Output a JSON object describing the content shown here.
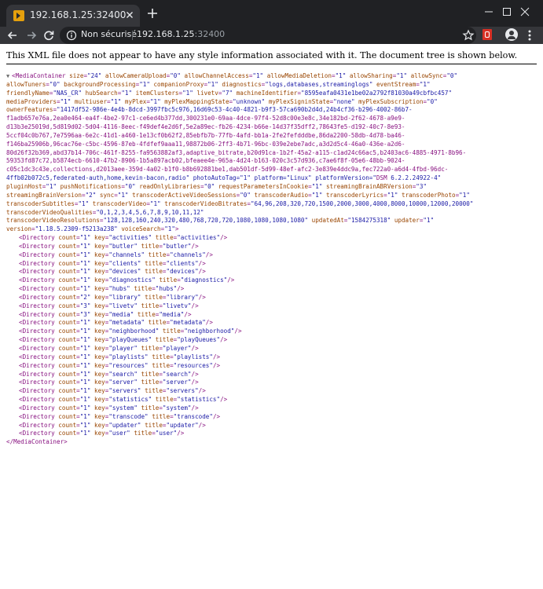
{
  "tab": {
    "title": "192.168.1.25:32400"
  },
  "omnibox": {
    "security_label": "Non sécurisé",
    "host": "192.168.1.25",
    "port": ":32400"
  },
  "page": {
    "info": "This XML file does not appear to have any style information associated with it. The document tree is shown below."
  },
  "xml": {
    "root_open_lines": [
      "<MediaContainer size=\"24\" allowCameraUpload=\"0\" allowChannelAccess=\"1\" allowMediaDeletion=\"1\" allowSharing=\"1\" allowSync=\"0\"",
      "allowTuners=\"0\" backgroundProcessing=\"1\" companionProxy=\"1\" diagnostics=\"logs,databases,streaminglogs\" eventStream=\"1\"",
      "friendlyName=\"NAS_CR\" hubSearch=\"1\" itemClusters=\"1\" livetv=\"7\" machineIdentifier=\"8595eafa0431e1be02a2792f81030a49cbfbc457\"",
      "mediaProviders=\"1\" multiuser=\"1\" myPlex=\"1\" myPlexMappingState=\"unknown\" myPlexSigninState=\"none\" myPlexSubscription=\"0\"",
      "ownerFeatures=\"1417df52-986e-4e4b-8dcd-3997fbc5c976,16d69c53-4c40-4821-b9f3-57ca690b2d4d,24b4cf36-b296-4002-86b7-",
      "f1adb657e76a,2ea0e464-ea4f-4be2-97c1-ce6ed4b377dd,300231e0-69aa-4dce-97f4-52d8c00e3e8c,34e182bd-2f62-4678-a9e9-",
      "d13b3e25019d,5d819d02-5d04-4116-8eec-f49def4e2d6f,5e2a89ec-fb26-4234-b66e-14d37f35dff2,78643fe5-d192-40c7-8e93-",
      "5ccf04c0b767,7e7596aa-6e2c-41d1-a460-1e13cf0b62f2,85ebfb7b-77fb-4afd-bb1a-2fe2fefdddbe,86da2200-58db-4d78-ba46-",
      "f146ba25906b,96cac76e-c5bc-4596-87eb-4fdfef9aaa11,98872b06-2ff3-4b71-96bc-039e2ebe7adc,a3d2d5c4-46a0-436e-a2d6-",
      "80d26f32b369,abd37b14-706c-461f-8255-fa9563882af3,adaptive_bitrate,b20d91ca-1b2f-45a2-a115-c1ad24c66ac5,b2403ac6-4885-4971-8b96-",
      "59353fd87c72,b5874ecb-6610-47b2-8906-1b5a897acb02,bfeaee4e-965a-4d24-b163-020c3c57d936,c7ae6f8f-05e6-48bb-9024-",
      "c05c1dc3c43e,collections,d2013aee-359d-4a02-b1f0-b8b692881be1,dab501df-5d99-48ef-afc2-3e839e4ddc9a,fec722a0-a6d4-4fbd-96dc-",
      "4ffb02b072c5,federated-auth,home,kevin-bacon,radio\" photoAutoTag=\"1\" platform=\"Linux\" platformVersion=\"DSM 6.2.2.24922-4\"",
      "pluginHost=\"1\" pushNotifications=\"0\" readOnlyLibraries=\"0\" requestParametersInCookie=\"1\" streamingBrainABRVersion=\"3\"",
      "streamingBrainVersion=\"2\" sync=\"1\" transcoderActiveVideoSessions=\"0\" transcoderAudio=\"1\" transcoderLyrics=\"1\" transcoderPhoto=\"1\"",
      "transcoderSubtitles=\"1\" transcoderVideo=\"1\" transcoderVideoBitrates=\"64,96,208,320,720,1500,2000,3000,4000,8000,10000,12000,20000\"",
      "transcoderVideoQualities=\"0,1,2,3,4,5,6,7,8,9,10,11,12\"",
      "transcoderVideoResolutions=\"128,128,160,240,320,480,768,720,720,1080,1080,1080,1080\" updatedAt=\"1584275318\" updater=\"1\"",
      "version=\"1.18.5.2309-f5213a238\" voiceSearch=\"1\">"
    ],
    "directories": [
      "<Directory count=\"1\" key=\"activities\" title=\"activities\"/>",
      "<Directory count=\"1\" key=\"butler\" title=\"butler\"/>",
      "<Directory count=\"1\" key=\"channels\" title=\"channels\"/>",
      "<Directory count=\"1\" key=\"clients\" title=\"clients\"/>",
      "<Directory count=\"1\" key=\"devices\" title=\"devices\"/>",
      "<Directory count=\"1\" key=\"diagnostics\" title=\"diagnostics\"/>",
      "<Directory count=\"1\" key=\"hubs\" title=\"hubs\"/>",
      "<Directory count=\"2\" key=\"library\" title=\"library\"/>",
      "<Directory count=\"3\" key=\"livetv\" title=\"livetv\"/>",
      "<Directory count=\"3\" key=\"media\" title=\"media\"/>",
      "<Directory count=\"1\" key=\"metadata\" title=\"metadata\"/>",
      "<Directory count=\"1\" key=\"neighborhood\" title=\"neighborhood\"/>",
      "<Directory count=\"1\" key=\"playQueues\" title=\"playQueues\"/>",
      "<Directory count=\"1\" key=\"player\" title=\"player\"/>",
      "<Directory count=\"1\" key=\"playlists\" title=\"playlists\"/>",
      "<Directory count=\"1\" key=\"resources\" title=\"resources\"/>",
      "<Directory count=\"1\" key=\"search\" title=\"search\"/>",
      "<Directory count=\"1\" key=\"server\" title=\"server\"/>",
      "<Directory count=\"1\" key=\"servers\" title=\"servers\"/>",
      "<Directory count=\"1\" key=\"statistics\" title=\"statistics\"/>",
      "<Directory count=\"1\" key=\"system\" title=\"system\"/>",
      "<Directory count=\"1\" key=\"transcode\" title=\"transcode\"/>",
      "<Directory count=\"1\" key=\"updater\" title=\"updater\"/>",
      "<Directory count=\"1\" key=\"user\" title=\"user\"/>"
    ],
    "root_close": "</MediaContainer>"
  }
}
